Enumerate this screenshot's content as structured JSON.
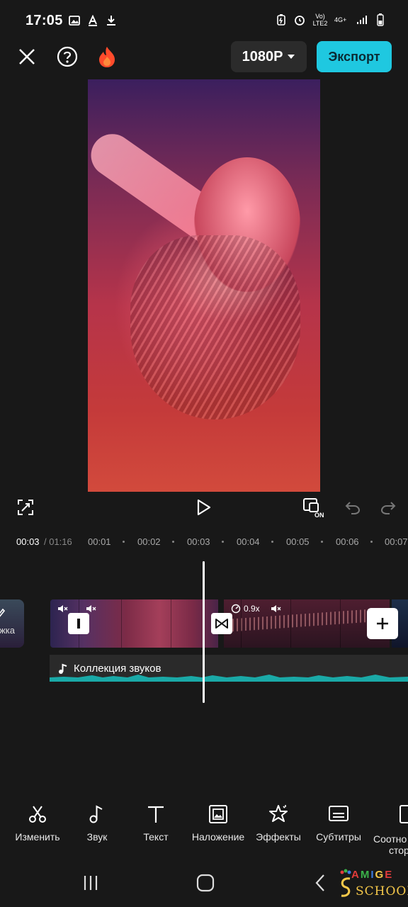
{
  "status": {
    "time": "17:05",
    "network_label": "Vo) LTE2",
    "network_type": "4G+"
  },
  "top_bar": {
    "resolution": "1080P",
    "export_label": "Экспорт",
    "accent": "#1fc8e0"
  },
  "timeline": {
    "current": "00:03",
    "total": "/ 01:16",
    "ticks": [
      "00:01",
      "00:02",
      "00:03",
      "00:04",
      "00:05",
      "00:06",
      "00:07"
    ],
    "left_clip_label": "ожка",
    "clip2_speed": "0.9x",
    "audio_label": "Коллекция звуков",
    "audio_color": "#1aa9a7"
  },
  "tools": [
    {
      "icon": "scissors-icon",
      "label": "Изменить"
    },
    {
      "icon": "music-note-icon",
      "label": "Звук"
    },
    {
      "icon": "text-icon",
      "label": "Текст"
    },
    {
      "icon": "overlay-icon",
      "label": "Наложение"
    },
    {
      "icon": "effects-star-icon",
      "label": "Эффекты"
    },
    {
      "icon": "subtitles-icon",
      "label": "Субтитры"
    }
  ],
  "tool_partial": {
    "line1": "Соотно",
    "line2": "стор"
  },
  "watermark": {
    "line1": "AMIGE",
    "line2": "SCHOOL"
  }
}
